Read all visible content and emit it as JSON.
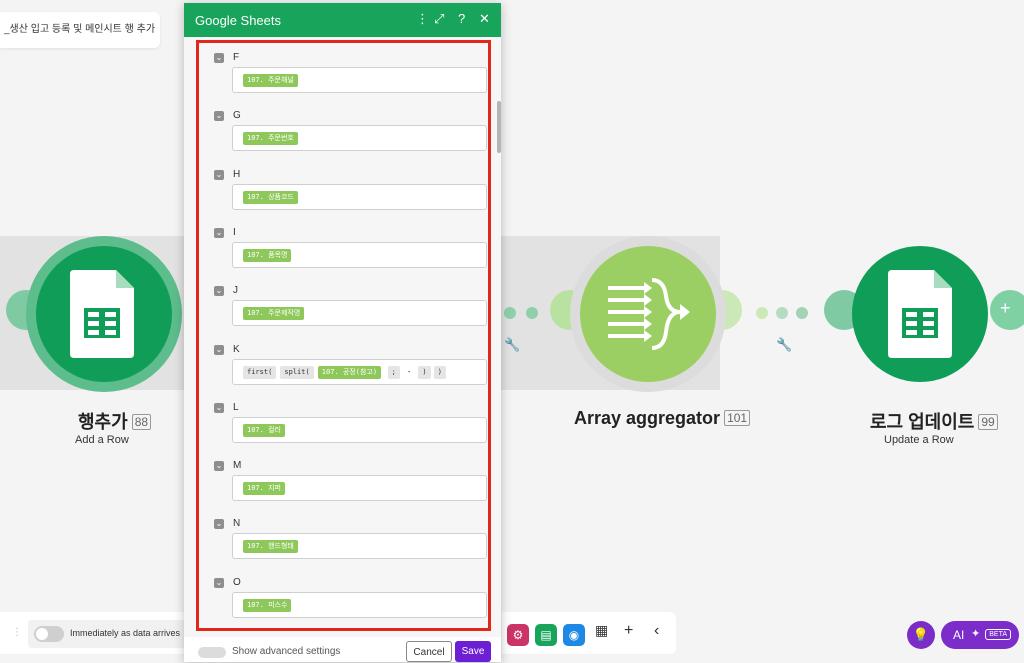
{
  "scenario": {
    "title": "_생산 입고 등록 및 메인시트 행 추가"
  },
  "modules": [
    {
      "name": "행추가",
      "id": "88",
      "subtitle": "Add a Row"
    },
    {
      "name": "Array aggregator",
      "id": "101",
      "subtitle": ""
    },
    {
      "name": "로그 업데이트",
      "id": "99",
      "subtitle": "Update a Row"
    }
  ],
  "dialog": {
    "title": "Google Sheets",
    "fields": [
      {
        "label": "F",
        "tokens": [
          {
            "text": "107. 주문채널",
            "kind": "var"
          }
        ]
      },
      {
        "label": "G",
        "tokens": [
          {
            "text": "107. 주문번호",
            "kind": "var"
          }
        ]
      },
      {
        "label": "H",
        "tokens": [
          {
            "text": "107. 상품코드",
            "kind": "var"
          }
        ]
      },
      {
        "label": "I",
        "tokens": [
          {
            "text": "107. 품목명",
            "kind": "var"
          }
        ]
      },
      {
        "label": "J",
        "tokens": [
          {
            "text": "107. 주문제작명",
            "kind": "var"
          }
        ]
      },
      {
        "label": "K",
        "tokens": [
          {
            "text": "first(",
            "kind": "func"
          },
          {
            "text": "split(",
            "kind": "func"
          },
          {
            "text": "107. 공정(참고)",
            "kind": "var"
          },
          {
            "text": ";",
            "kind": "func"
          },
          {
            "text": "-",
            "kind": "plain"
          },
          {
            "text": ")",
            "kind": "func"
          },
          {
            "text": ")",
            "kind": "func"
          }
        ]
      },
      {
        "label": "L",
        "tokens": [
          {
            "text": "107. 컬러",
            "kind": "var"
          }
        ]
      },
      {
        "label": "M",
        "tokens": [
          {
            "text": "107. 지퍼",
            "kind": "var"
          }
        ]
      },
      {
        "label": "N",
        "tokens": [
          {
            "text": "107. 핸드형태",
            "kind": "var"
          }
        ]
      },
      {
        "label": "O",
        "tokens": [
          {
            "text": "107. 피스수",
            "kind": "var"
          }
        ]
      }
    ],
    "advanced_label": "Show advanced settings",
    "cancel_label": "Cancel",
    "save_label": "Save"
  },
  "schedule": {
    "label": "Immediately as data arrives"
  },
  "ai": {
    "label": "AI",
    "badge": "BETA"
  },
  "colors": {
    "sheets_green": "#19a45c",
    "aggregator_green": "#8ec85a",
    "highlight_red": "#e1261c",
    "save_purple": "#6d1fd6",
    "ai_purple": "#7b2cc9"
  }
}
